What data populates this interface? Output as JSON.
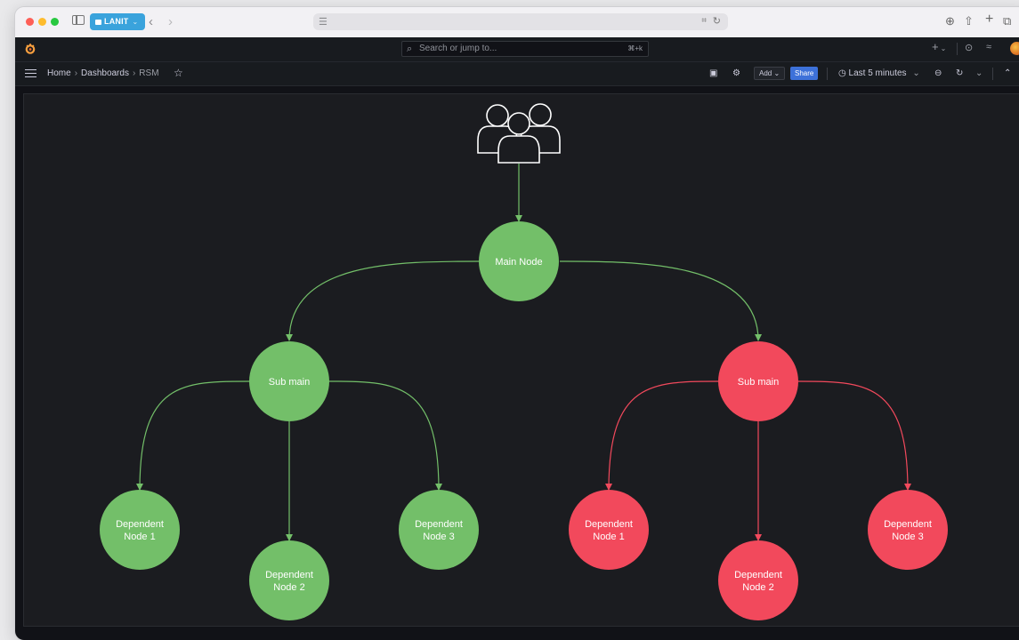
{
  "browser": {
    "tab_group_label": "LANIT",
    "address_placeholder": ""
  },
  "grafana": {
    "search_placeholder": "Search or jump to...",
    "search_shortcut": "⌘+k",
    "breadcrumb": [
      "Home",
      "Dashboards",
      "RSM"
    ],
    "add_label": "Add",
    "share_label": "Share",
    "time_range": "Last 5 minutes"
  },
  "diagram": {
    "colors": {
      "green": "#73bf69",
      "red": "#f2495c",
      "icon_stroke": "#ffffff"
    },
    "main_node": "Main Node",
    "left_branch": {
      "sub": "Sub main",
      "deps": [
        [
          "Dependent",
          "Node 1"
        ],
        [
          "Dependent",
          "Node 2"
        ],
        [
          "Dependent",
          "Node 3"
        ]
      ]
    },
    "right_branch": {
      "sub": "Sub main",
      "deps": [
        [
          "Dependent",
          "Node 1"
        ],
        [
          "Dependent",
          "Node 2"
        ],
        [
          "Dependent",
          "Node 3"
        ]
      ]
    }
  }
}
